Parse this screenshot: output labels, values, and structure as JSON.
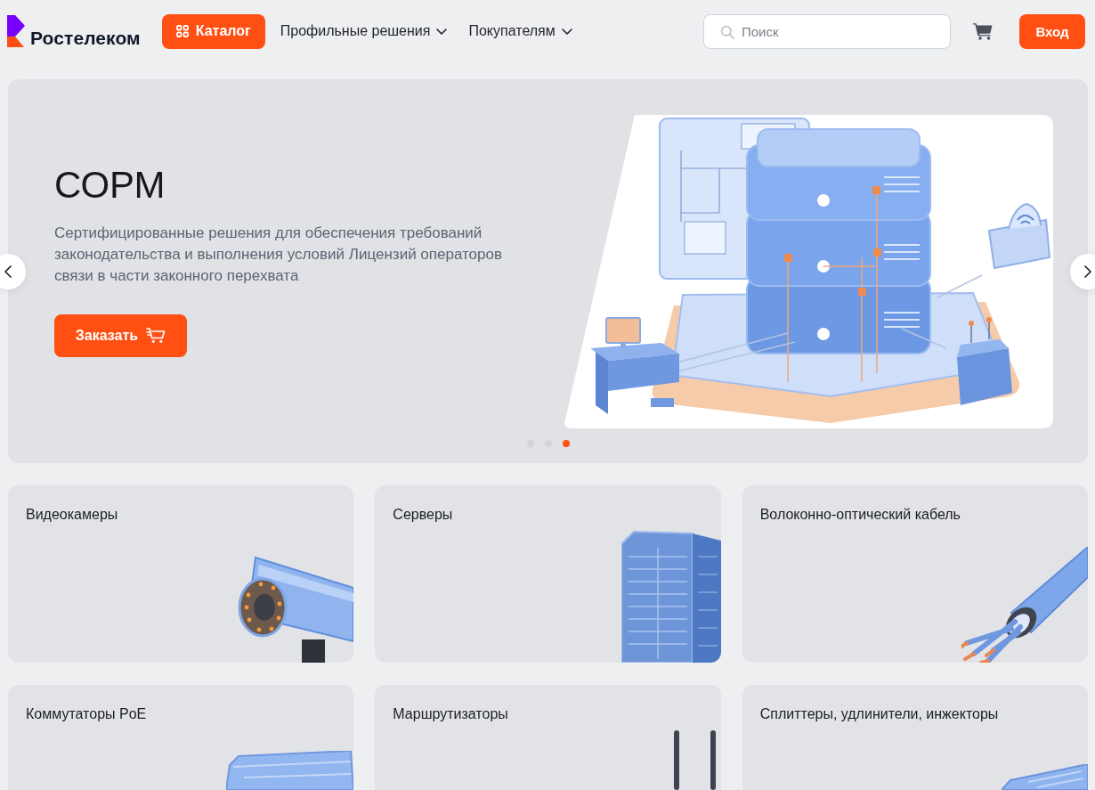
{
  "header": {
    "logo_text": "Ростелеком",
    "catalog_button": "Каталог",
    "nav": [
      {
        "label": "Профильные решения"
      },
      {
        "label": "Покупателям"
      }
    ],
    "search": {
      "placeholder": "Поиск"
    },
    "login_button": "Вход"
  },
  "hero": {
    "title": "СОРМ",
    "description": "Сертифицированные решения для обеспечения требований законодательства и выполнения условий Лицензий операторов связи в части законного перехвата",
    "order_button": "Заказать",
    "dots": [
      {
        "selected": false
      },
      {
        "selected": false
      },
      {
        "selected": true
      }
    ]
  },
  "categories": [
    {
      "title": "Видеокамеры",
      "kind": "camera"
    },
    {
      "title": "Серверы",
      "kind": "rack"
    },
    {
      "title": "Волоконно-оптический кабель",
      "kind": "cable"
    },
    {
      "title": "Коммутаторы PoE",
      "kind": "switch"
    },
    {
      "title": "Маршрутизаторы",
      "kind": "router"
    },
    {
      "title": "Сплиттеры, удлинители, инжекторы",
      "kind": "splitter"
    }
  ]
}
